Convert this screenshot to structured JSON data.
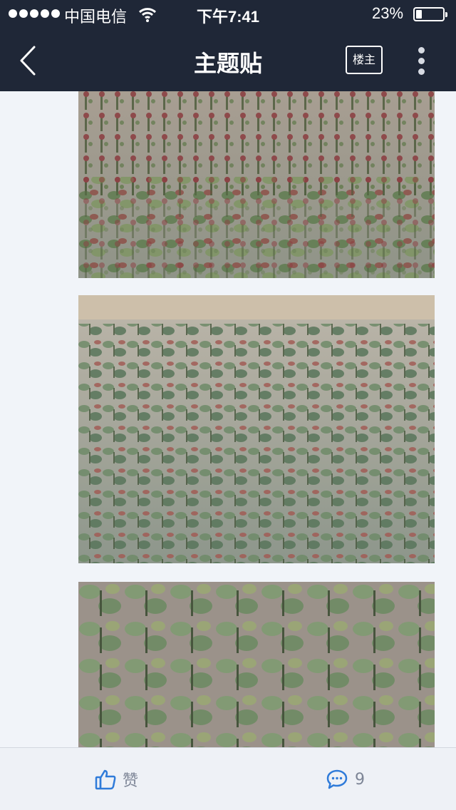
{
  "status_bar": {
    "carrier": "中国电信",
    "time": "下午7:41",
    "battery_percent": "23%",
    "battery_level": 0.23
  },
  "nav": {
    "title": "主题贴",
    "op_label": "楼主",
    "icons": [
      "back-chevron-icon",
      "more-vertical-icon"
    ]
  },
  "post": {
    "photos": [
      "rose-cuttings-photo-1",
      "rose-cuttings-photo-2",
      "rose-cuttings-photo-3"
    ]
  },
  "actions": {
    "like_label": "赞",
    "comment_count": "9"
  },
  "colors": {
    "header_bg": "#1f2737",
    "page_bg": "#f1f4f9",
    "accent_blue": "#2f7bd9",
    "action_text": "#7d8596"
  }
}
